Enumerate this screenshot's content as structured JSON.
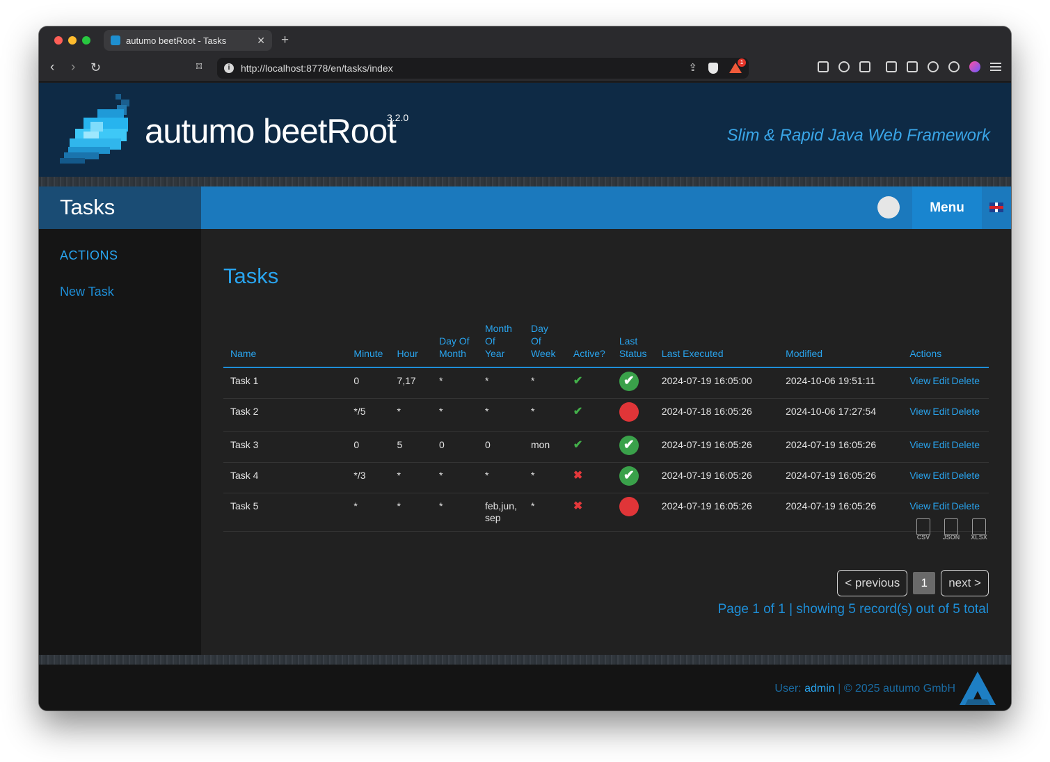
{
  "browser": {
    "tab_title": "autumo beetRoot - Tasks",
    "tab_close": "✕",
    "new_tab": "+",
    "url": "http://localhost:8778/en/tasks/index",
    "rewards_badge": "1"
  },
  "header": {
    "brand": "autumo beetRoot",
    "version": "3.2.0",
    "tagline": "Slim & Rapid Java Web Framework"
  },
  "subnav": {
    "title": "Tasks",
    "menu_label": "Menu"
  },
  "sidebar": {
    "heading": "ACTIONS",
    "link": "New Task"
  },
  "main": {
    "title": "Tasks",
    "columns": [
      "Name",
      "Minute",
      "Hour",
      "Day Of Month",
      "Month Of Year",
      "Day Of Week",
      "Active?",
      "Last Status",
      "Last Executed",
      "Modified",
      "Actions"
    ],
    "rows": [
      {
        "name": "Task 1",
        "minute": "0",
        "hour": "7,17",
        "dom": "*",
        "moy": "*",
        "dow": "*",
        "active": true,
        "status": "ok",
        "last_executed": "2024-07-19 16:05:00",
        "modified": "2024-10-06 19:51:11"
      },
      {
        "name": "Task 2",
        "minute": "*/5",
        "hour": "*",
        "dom": "*",
        "moy": "*",
        "dow": "*",
        "active": true,
        "status": "fail",
        "last_executed": "2024-07-18 16:05:26",
        "modified": "2024-10-06 17:27:54"
      },
      {
        "name": "Task 3",
        "minute": "0",
        "hour": "5",
        "dom": "0",
        "moy": "0",
        "dow": "mon",
        "active": true,
        "status": "ok",
        "last_executed": "2024-07-19 16:05:26",
        "modified": "2024-07-19 16:05:26"
      },
      {
        "name": "Task 4",
        "minute": "*/3",
        "hour": "*",
        "dom": "*",
        "moy": "*",
        "dow": "*",
        "active": false,
        "status": "ok",
        "last_executed": "2024-07-19 16:05:26",
        "modified": "2024-07-19 16:05:26"
      },
      {
        "name": "Task 5",
        "minute": "*",
        "hour": "*",
        "dom": "*",
        "moy": "feb,jun,sep",
        "dow": "*",
        "active": false,
        "status": "fail",
        "last_executed": "2024-07-19 16:05:26",
        "modified": "2024-07-19 16:05:26"
      }
    ],
    "row_actions": [
      "View",
      "Edit",
      "Delete"
    ],
    "exports": [
      "CSV",
      "JSON",
      "XLSX"
    ],
    "pager": {
      "previous": "< previous",
      "current": "1",
      "next": "next >",
      "info": "Page 1 of 1 | showing 5 record(s) out of 5 total"
    }
  },
  "footer": {
    "user_prefix": "User: ",
    "user": "admin",
    "copyright": " | © 2025 autumo GmbH"
  },
  "colors": {
    "accent": "#29a4ee",
    "header_bg": "#0e2a45",
    "subnav_bg": "#1b79bd",
    "ok": "#3aa14a",
    "fail": "#e03538"
  }
}
